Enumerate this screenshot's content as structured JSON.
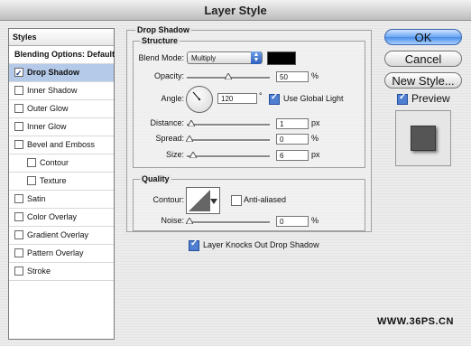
{
  "window": {
    "title": "Layer Style"
  },
  "styles_panel": {
    "header": "Styles",
    "items": [
      {
        "label": "Blending Options: Default",
        "checkbox": false,
        "bold": true
      },
      {
        "label": "Drop Shadow",
        "checkbox": true,
        "checked": true,
        "selected": true
      },
      {
        "label": "Inner Shadow",
        "checkbox": true,
        "checked": false
      },
      {
        "label": "Outer Glow",
        "checkbox": true,
        "checked": false
      },
      {
        "label": "Inner Glow",
        "checkbox": true,
        "checked": false
      },
      {
        "label": "Bevel and Emboss",
        "checkbox": true,
        "checked": false
      },
      {
        "label": "Contour",
        "checkbox": true,
        "checked": false,
        "sub": true
      },
      {
        "label": "Texture",
        "checkbox": true,
        "checked": false,
        "sub": true
      },
      {
        "label": "Satin",
        "checkbox": true,
        "checked": false
      },
      {
        "label": "Color Overlay",
        "checkbox": true,
        "checked": false
      },
      {
        "label": "Gradient Overlay",
        "checkbox": true,
        "checked": false
      },
      {
        "label": "Pattern Overlay",
        "checkbox": true,
        "checked": false
      },
      {
        "label": "Stroke",
        "checkbox": true,
        "checked": false
      }
    ]
  },
  "drop_shadow": {
    "section_title": "Drop Shadow",
    "structure": {
      "title": "Structure",
      "blend_mode_label": "Blend Mode:",
      "blend_mode_value": "Multiply",
      "shadow_color": "#000000",
      "opacity_label": "Opacity:",
      "opacity_value": "50",
      "opacity_unit": "%",
      "angle_label": "Angle:",
      "angle_value": "120",
      "angle_unit": "°",
      "use_global_light_label": "Use Global Light",
      "use_global_light": true,
      "distance_label": "Distance:",
      "distance_value": "1",
      "distance_unit": "px",
      "spread_label": "Spread:",
      "spread_value": "0",
      "spread_unit": "%",
      "size_label": "Size:",
      "size_value": "6",
      "size_unit": "px"
    },
    "quality": {
      "title": "Quality",
      "contour_label": "Contour:",
      "anti_aliased_label": "Anti-aliased",
      "anti_aliased": false,
      "noise_label": "Noise:",
      "noise_value": "0",
      "noise_unit": "%"
    },
    "knocks_out_label": "Layer Knocks Out Drop Shadow",
    "knocks_out": true
  },
  "buttons": {
    "ok": "OK",
    "cancel": "Cancel",
    "new_style": "New Style..."
  },
  "preview": {
    "label": "Preview",
    "checked": true
  },
  "watermark": "WWW.36PS.CN"
}
